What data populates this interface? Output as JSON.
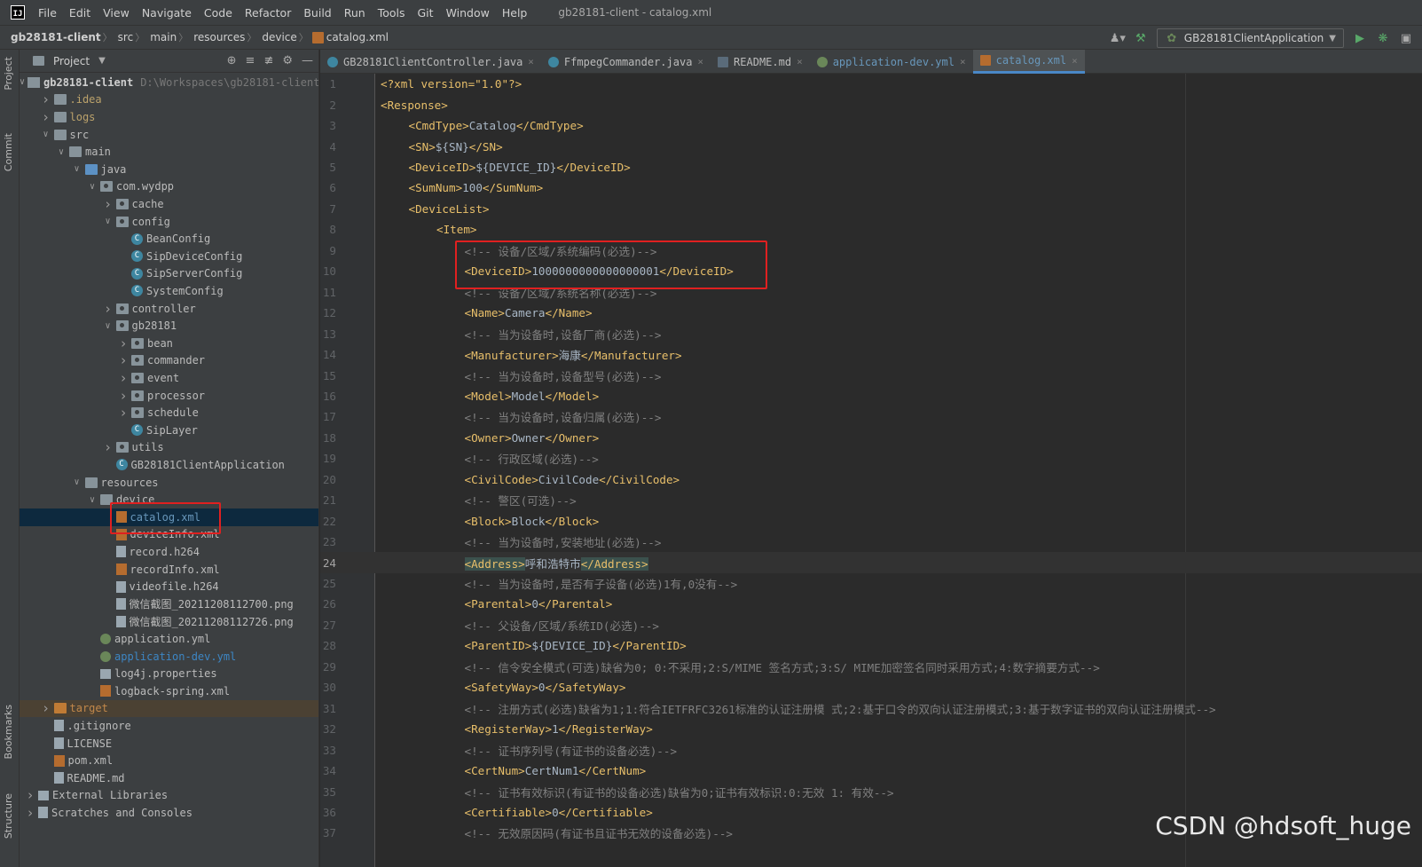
{
  "menubar": {
    "logo": "IJ",
    "items": [
      "File",
      "Edit",
      "View",
      "Navigate",
      "Code",
      "Refactor",
      "Build",
      "Run",
      "Tools",
      "Git",
      "Window",
      "Help"
    ],
    "window_title": "gb28181-client - catalog.xml"
  },
  "breadcrumb": {
    "items": [
      "gb28181-client",
      "src",
      "main",
      "resources",
      "device"
    ],
    "current_file": "catalog.xml"
  },
  "toolbar": {
    "run_config": "GB28181ClientApplication"
  },
  "tool_stripe": {
    "project": "Project",
    "commit": "Commit",
    "bookmarks": "Bookmarks",
    "structure": "Structure"
  },
  "project_panel": {
    "title": "Project",
    "tree": [
      {
        "label": "gb28181-client",
        "hint": "D:\\Workspaces\\gb28181-client",
        "depth": 0,
        "chev": "v",
        "icon": "module",
        "color": "bold"
      },
      {
        "label": ".idea",
        "depth": 1,
        "chev": ">",
        "icon": "folder",
        "color": "yellow"
      },
      {
        "label": "logs",
        "depth": 1,
        "chev": ">",
        "icon": "folder",
        "color": "yellow"
      },
      {
        "label": "src",
        "depth": 1,
        "chev": "v",
        "icon": "folder",
        "color": ""
      },
      {
        "label": "main",
        "depth": 2,
        "chev": "v",
        "icon": "folder",
        "color": ""
      },
      {
        "label": "java",
        "depth": 3,
        "chev": "v",
        "icon": "folder-blue",
        "color": ""
      },
      {
        "label": "com.wydpp",
        "depth": 4,
        "chev": "v",
        "icon": "pkg",
        "color": ""
      },
      {
        "label": "cache",
        "depth": 5,
        "chev": ">",
        "icon": "pkg",
        "color": ""
      },
      {
        "label": "config",
        "depth": 5,
        "chev": "v",
        "icon": "pkg",
        "color": ""
      },
      {
        "label": "BeanConfig",
        "depth": 6,
        "chev": "",
        "icon": "class",
        "color": ""
      },
      {
        "label": "SipDeviceConfig",
        "depth": 6,
        "chev": "",
        "icon": "class",
        "color": ""
      },
      {
        "label": "SipServerConfig",
        "depth": 6,
        "chev": "",
        "icon": "class",
        "color": ""
      },
      {
        "label": "SystemConfig",
        "depth": 6,
        "chev": "",
        "icon": "class",
        "color": ""
      },
      {
        "label": "controller",
        "depth": 5,
        "chev": ">",
        "icon": "pkg",
        "color": ""
      },
      {
        "label": "gb28181",
        "depth": 5,
        "chev": "v",
        "icon": "pkg",
        "color": ""
      },
      {
        "label": "bean",
        "depth": 6,
        "chev": ">",
        "icon": "pkg",
        "color": ""
      },
      {
        "label": "commander",
        "depth": 6,
        "chev": ">",
        "icon": "pkg",
        "color": ""
      },
      {
        "label": "event",
        "depth": 6,
        "chev": ">",
        "icon": "pkg",
        "color": ""
      },
      {
        "label": "processor",
        "depth": 6,
        "chev": ">",
        "icon": "pkg",
        "color": ""
      },
      {
        "label": "schedule",
        "depth": 6,
        "chev": ">",
        "icon": "pkg",
        "color": ""
      },
      {
        "label": "SipLayer",
        "depth": 6,
        "chev": "",
        "icon": "class",
        "color": ""
      },
      {
        "label": "utils",
        "depth": 5,
        "chev": ">",
        "icon": "pkg",
        "color": ""
      },
      {
        "label": "GB28181ClientApplication",
        "depth": 5,
        "chev": "",
        "icon": "class",
        "color": ""
      },
      {
        "label": "resources",
        "depth": 3,
        "chev": "v",
        "icon": "folder",
        "color": ""
      },
      {
        "label": "device",
        "depth": 4,
        "chev": "v",
        "icon": "folder",
        "color": ""
      },
      {
        "label": "catalog.xml",
        "depth": 5,
        "chev": "",
        "icon": "xml",
        "color": "selected"
      },
      {
        "label": "deviceInfo.xml",
        "depth": 5,
        "chev": "",
        "icon": "xml",
        "color": ""
      },
      {
        "label": "record.h264",
        "depth": 5,
        "chev": "",
        "icon": "file",
        "color": ""
      },
      {
        "label": "recordInfo.xml",
        "depth": 5,
        "chev": "",
        "icon": "xml",
        "color": ""
      },
      {
        "label": "videofile.h264",
        "depth": 5,
        "chev": "",
        "icon": "file",
        "color": ""
      },
      {
        "label": "微信截图_20211208112700.png",
        "depth": 5,
        "chev": "",
        "icon": "file",
        "color": ""
      },
      {
        "label": "微信截图_20211208112726.png",
        "depth": 5,
        "chev": "",
        "icon": "file",
        "color": ""
      },
      {
        "label": "application.yml",
        "depth": 4,
        "chev": "",
        "icon": "yml",
        "color": ""
      },
      {
        "label": "application-dev.yml",
        "depth": 4,
        "chev": "",
        "icon": "yml",
        "color": "blue"
      },
      {
        "label": "log4j.properties",
        "depth": 4,
        "chev": "",
        "icon": "lib",
        "color": ""
      },
      {
        "label": "logback-spring.xml",
        "depth": 4,
        "chev": "",
        "icon": "xml",
        "color": ""
      },
      {
        "label": "target",
        "depth": 1,
        "chev": ">",
        "icon": "folder-orange",
        "color": "orange"
      },
      {
        "label": ".gitignore",
        "depth": 1,
        "chev": "",
        "icon": "file",
        "color": ""
      },
      {
        "label": "LICENSE",
        "depth": 1,
        "chev": "",
        "icon": "file",
        "color": ""
      },
      {
        "label": "pom.xml",
        "depth": 1,
        "chev": "",
        "icon": "xml",
        "color": ""
      },
      {
        "label": "README.md",
        "depth": 1,
        "chev": "",
        "icon": "file",
        "color": ""
      },
      {
        "label": "External Libraries",
        "depth": 0,
        "chev": ">",
        "icon": "lib",
        "color": ""
      },
      {
        "label": "Scratches and Consoles",
        "depth": 0,
        "chev": ">",
        "icon": "file",
        "color": ""
      }
    ]
  },
  "tabs": [
    {
      "label": "GB28181ClientController.java",
      "icon": "java",
      "active": false
    },
    {
      "label": "FfmpegCommander.java",
      "icon": "java",
      "active": false
    },
    {
      "label": "README.md",
      "icon": "md",
      "active": false
    },
    {
      "label": "application-dev.yml",
      "icon": "yml",
      "active": false
    },
    {
      "label": "catalog.xml",
      "icon": "xml",
      "active": true
    }
  ],
  "editor": {
    "current_line": 24,
    "lines": [
      {
        "n": "1",
        "i": 0,
        "k": "decl",
        "t": "<?xml version=\"1.0\"?>"
      },
      {
        "n": "2",
        "i": 0,
        "k": "open",
        "t": "<Response>"
      },
      {
        "n": "3",
        "i": 1,
        "k": "el",
        "tag": "CmdType",
        "v": "Catalog"
      },
      {
        "n": "4",
        "i": 1,
        "k": "el",
        "tag": "SN",
        "v": "${SN}"
      },
      {
        "n": "5",
        "i": 1,
        "k": "el",
        "tag": "DeviceID",
        "v": "${DEVICE_ID}"
      },
      {
        "n": "6",
        "i": 1,
        "k": "el",
        "tag": "SumNum",
        "v": "100"
      },
      {
        "n": "7",
        "i": 1,
        "k": "open",
        "t": "<DeviceList>"
      },
      {
        "n": "8",
        "i": 2,
        "k": "open",
        "t": "<Item>"
      },
      {
        "n": "9",
        "i": 3,
        "k": "cm",
        "t": "<!-- 设备/区域/系统编码(必选)-->"
      },
      {
        "n": "10",
        "i": 3,
        "k": "el",
        "tag": "DeviceID",
        "v": "1000000000000000001"
      },
      {
        "n": "11",
        "i": 3,
        "k": "cm",
        "t": "<!-- 设备/区域/系统名称(必选)-->"
      },
      {
        "n": "12",
        "i": 3,
        "k": "el",
        "tag": "Name",
        "v": "Camera"
      },
      {
        "n": "13",
        "i": 3,
        "k": "cm",
        "t": "<!-- 当为设备时,设备厂商(必选)-->"
      },
      {
        "n": "14",
        "i": 3,
        "k": "el",
        "tag": "Manufacturer",
        "v": "海康"
      },
      {
        "n": "15",
        "i": 3,
        "k": "cm",
        "t": "<!-- 当为设备时,设备型号(必选)-->"
      },
      {
        "n": "16",
        "i": 3,
        "k": "el",
        "tag": "Model",
        "v": "Model"
      },
      {
        "n": "17",
        "i": 3,
        "k": "cm",
        "t": "<!-- 当为设备时,设备归属(必选)-->"
      },
      {
        "n": "18",
        "i": 3,
        "k": "el",
        "tag": "Owner",
        "v": "Owner"
      },
      {
        "n": "19",
        "i": 3,
        "k": "cm",
        "t": "<!-- 行政区域(必选)-->"
      },
      {
        "n": "20",
        "i": 3,
        "k": "el",
        "tag": "CivilCode",
        "v": "CivilCode"
      },
      {
        "n": "21",
        "i": 3,
        "k": "cm",
        "t": "<!-- 警区(可选)-->"
      },
      {
        "n": "22",
        "i": 3,
        "k": "el",
        "tag": "Block",
        "v": "Block"
      },
      {
        "n": "23",
        "i": 3,
        "k": "cm",
        "t": "<!-- 当为设备时,安装地址(必选)-->"
      },
      {
        "n": "24",
        "i": 3,
        "k": "el",
        "tag": "Address",
        "v": "呼和浩特市",
        "match": true
      },
      {
        "n": "25",
        "i": 3,
        "k": "cm",
        "t": "<!-- 当为设备时,是否有子设备(必选)1有,0没有-->"
      },
      {
        "n": "26",
        "i": 3,
        "k": "el",
        "tag": "Parental",
        "v": "0"
      },
      {
        "n": "27",
        "i": 3,
        "k": "cm",
        "t": "<!-- 父设备/区域/系统ID(必选)-->"
      },
      {
        "n": "28",
        "i": 3,
        "k": "el",
        "tag": "ParentID",
        "v": "${DEVICE_ID}"
      },
      {
        "n": "29",
        "i": 3,
        "k": "cm",
        "t": "<!-- 信令安全模式(可选)缺省为0; 0:不采用;2:S/MIME 签名方式;3:S/ MIME加密签名同时采用方式;4:数字摘要方式-->"
      },
      {
        "n": "30",
        "i": 3,
        "k": "el",
        "tag": "SafetyWay",
        "v": "0"
      },
      {
        "n": "31",
        "i": 3,
        "k": "cm",
        "t": "<!-- 注册方式(必选)缺省为1;1:符合IETFRFC3261标准的认证注册模 式;2:基于口令的双向认证注册模式;3:基于数字证书的双向认证注册模式-->"
      },
      {
        "n": "32",
        "i": 3,
        "k": "el",
        "tag": "RegisterWay",
        "v": "1"
      },
      {
        "n": "33",
        "i": 3,
        "k": "cm",
        "t": "<!-- 证书序列号(有证书的设备必选)-->"
      },
      {
        "n": "34",
        "i": 3,
        "k": "el",
        "tag": "CertNum",
        "v": "CertNum1"
      },
      {
        "n": "35",
        "i": 3,
        "k": "cm",
        "t": "<!-- 证书有效标识(有证书的设备必选)缺省为0;证书有效标识:0:无效 1: 有效-->"
      },
      {
        "n": "36",
        "i": 3,
        "k": "el",
        "tag": "Certifiable",
        "v": "0"
      },
      {
        "n": "37",
        "i": 3,
        "k": "cm",
        "t": "<!-- 无效原因码(有证书且证书无效的设备必选)-->"
      }
    ]
  },
  "watermark": "CSDN @hdsoft_huge"
}
